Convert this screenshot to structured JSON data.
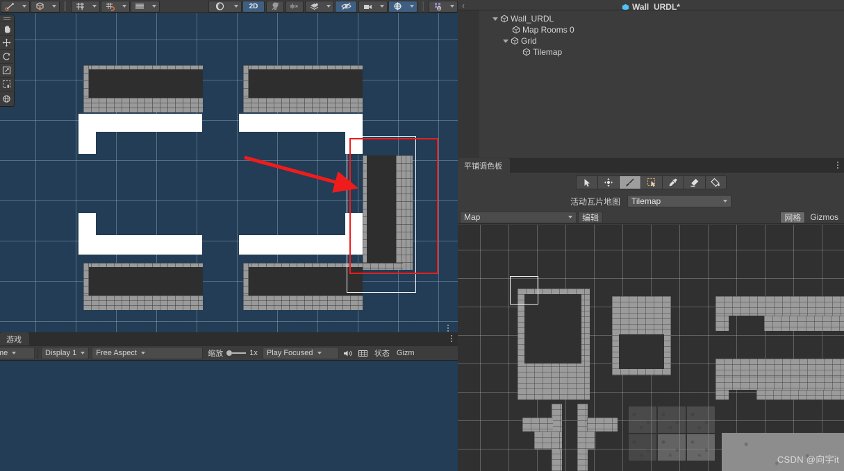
{
  "app": {
    "prefab_title": "Wall_URDL*",
    "back_icon": "back-chevron-icon",
    "watermark": "CSDN @向宇it"
  },
  "scene_toolbar": {
    "groups": [
      {
        "name": "tool-handle-pivot",
        "icon": "pivot-rotate-icon",
        "has_dropdown": true,
        "active": false
      },
      {
        "name": "tool-handle-space",
        "icon": "global-local-cube-icon",
        "has_dropdown": true,
        "active": false
      },
      {
        "name": "grid-snap-axis",
        "icon": "grid-axis-y-icon",
        "has_dropdown": true,
        "active": false
      },
      {
        "name": "grid-snap-toggle",
        "icon": "grid-magnet-icon",
        "has_dropdown": true,
        "active": false
      },
      {
        "name": "increment-snap",
        "icon": "increment-snap-icon",
        "has_dropdown": true,
        "active": false
      },
      {
        "name": "scene-shading-mode",
        "icon": "shaded-sphere-icon",
        "has_dropdown": true,
        "active": false
      },
      {
        "name": "scene-2d-toggle",
        "label": "2D",
        "has_dropdown": false,
        "active": true
      },
      {
        "name": "scene-lighting-toggle",
        "icon": "light-bulb-icon",
        "has_dropdown": false,
        "active": false
      },
      {
        "name": "scene-audio-toggle",
        "icon": "audio-muted-icon",
        "has_dropdown": false,
        "active": false
      },
      {
        "name": "scene-fx-toggle",
        "icon": "effects-layers-icon",
        "has_dropdown": true,
        "active": false
      },
      {
        "name": "scene-visibility-toggle",
        "icon": "eye-hidden-icon",
        "has_dropdown": false,
        "active": true
      },
      {
        "name": "scene-camera-settings",
        "icon": "camera-icon",
        "has_dropdown": true,
        "active": false
      },
      {
        "name": "scene-gizmos-toggle",
        "icon": "gizmo-globe-icon",
        "has_dropdown": true,
        "active": true
      },
      {
        "name": "scene-grid-visibility",
        "icon": "grid-dots-icon",
        "has_dropdown": true,
        "active": false
      }
    ],
    "label_2d": "2D"
  },
  "scene_tools_strip": [
    {
      "name": "hand-tool",
      "icon": "hand-icon"
    },
    {
      "name": "move-tool",
      "icon": "move-arrows-icon"
    },
    {
      "name": "rotate-tool",
      "icon": "rotate-arc-icon"
    },
    {
      "name": "scale-tool",
      "icon": "scale-arrow-icon"
    },
    {
      "name": "rect-tool",
      "icon": "rect-transform-icon"
    },
    {
      "name": "transform-tool",
      "icon": "transform-globe-icon"
    }
  ],
  "game_panel": {
    "tab_label": "游戏",
    "controls": [
      {
        "name": "game-target-display",
        "label": "me",
        "type": "dropdown"
      },
      {
        "name": "display-selector",
        "label": "Display 1",
        "type": "dropdown"
      },
      {
        "name": "aspect-selector",
        "label": "Free Aspect",
        "type": "dropdown"
      },
      {
        "name": "zoom-label",
        "label": "缩放",
        "type": "label"
      },
      {
        "name": "zoom-value",
        "label": "1x",
        "type": "label"
      },
      {
        "name": "play-mode-selector",
        "label": "Play Focused",
        "type": "dropdown"
      },
      {
        "name": "mute-audio-button",
        "icon": "speaker-icon",
        "type": "icon"
      },
      {
        "name": "game-grid-button",
        "icon": "grid-frame-icon",
        "type": "icon"
      },
      {
        "name": "stats-button",
        "label": "状态",
        "type": "button"
      },
      {
        "name": "gizmos-button",
        "label": "Gizm",
        "type": "button"
      }
    ]
  },
  "hierarchy": {
    "items": [
      {
        "label": "Wall_URDL",
        "depth": 0,
        "expanded": true,
        "icon": "prefab-cube-icon"
      },
      {
        "label": "Map Rooms 0",
        "depth": 1,
        "expanded": null,
        "icon": "prefab-cube-icon"
      },
      {
        "label": "Grid",
        "depth": 1,
        "expanded": true,
        "icon": "prefab-cube-icon"
      },
      {
        "label": "Tilemap",
        "depth": 2,
        "expanded": null,
        "icon": "prefab-cube-icon"
      }
    ]
  },
  "palette": {
    "tab_label": "平铺调色板",
    "menu_icon": "kebab-menu-icon",
    "tools": [
      {
        "name": "palette-select-tool",
        "icon": "cursor-arrow-icon",
        "active": false
      },
      {
        "name": "palette-move-tool",
        "icon": "move-arrows-icon",
        "active": false
      },
      {
        "name": "palette-brush-tool",
        "icon": "paintbrush-icon",
        "active": true
      },
      {
        "name": "palette-box-fill-tool",
        "icon": "box-select-icon",
        "active": false
      },
      {
        "name": "palette-picker-tool",
        "icon": "eyedropper-icon",
        "active": false
      },
      {
        "name": "palette-eraser-tool",
        "icon": "eraser-icon",
        "active": false
      },
      {
        "name": "palette-fill-tool",
        "icon": "paint-bucket-icon",
        "active": false
      }
    ],
    "active_tilemap_label": "活动瓦片地图",
    "active_tilemap_value": "Tilemap",
    "palette_selector_value": "Map",
    "edit_button": "编辑",
    "grid_button": "网格",
    "gizmos_button": "Gizmos"
  },
  "colors": {
    "scene_background": "#223d55",
    "scene_grid_line": "#96afc3",
    "selection_white": "#ffffff",
    "annotation_red": "#f01c1c",
    "panel_bg": "#3c3c3c",
    "palette_bg": "#303030",
    "toolbar_active": "#3e5f82",
    "brick_gray": "#9b9b9b",
    "room_dark": "#2e2e2e"
  }
}
